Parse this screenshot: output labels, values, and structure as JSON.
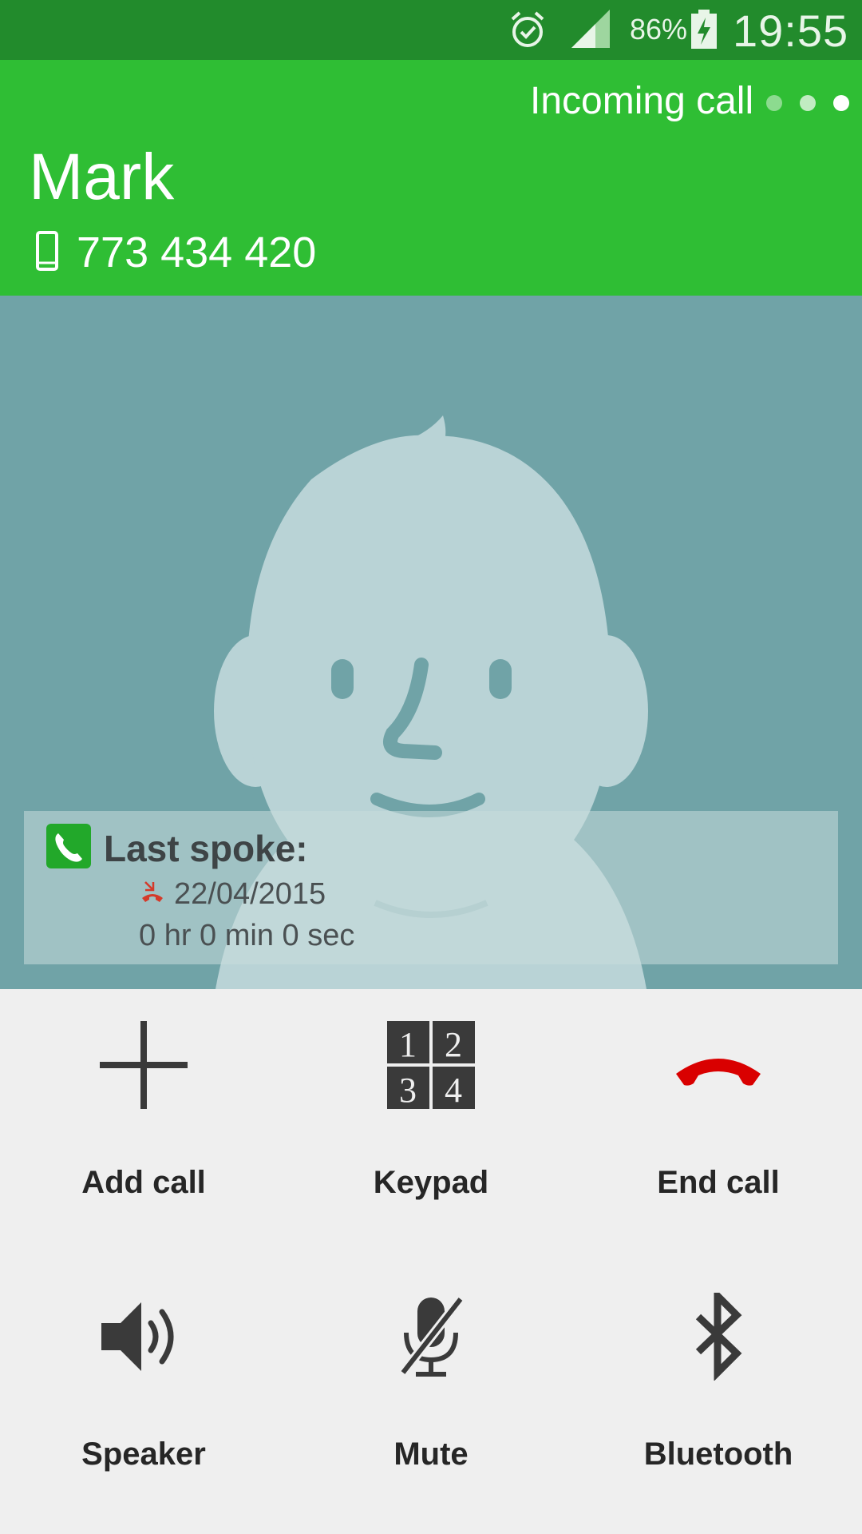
{
  "status_bar": {
    "battery_percent": "86%",
    "time": "19:55"
  },
  "header": {
    "status_label": "Incoming call",
    "contact_name": "Mark",
    "phone_number": "773 434 420"
  },
  "last_spoke": {
    "title": "Last spoke:",
    "date": "22/04/2015",
    "duration": "0 hr 0 min 0 sec"
  },
  "controls": [
    {
      "label": "Add call",
      "icon": "plus-icon"
    },
    {
      "label": "Keypad",
      "icon": "keypad-icon"
    },
    {
      "label": "End call",
      "icon": "end-call-icon",
      "color": "#d90000"
    },
    {
      "label": "Speaker",
      "icon": "speaker-icon"
    },
    {
      "label": "Mute",
      "icon": "mute-icon"
    },
    {
      "label": "Bluetooth",
      "icon": "bluetooth-icon"
    }
  ],
  "colors": {
    "status_bar": "#228b2c",
    "header": "#2fbe34",
    "photo_bg": "#70a3a7",
    "end_call": "#d90000"
  }
}
